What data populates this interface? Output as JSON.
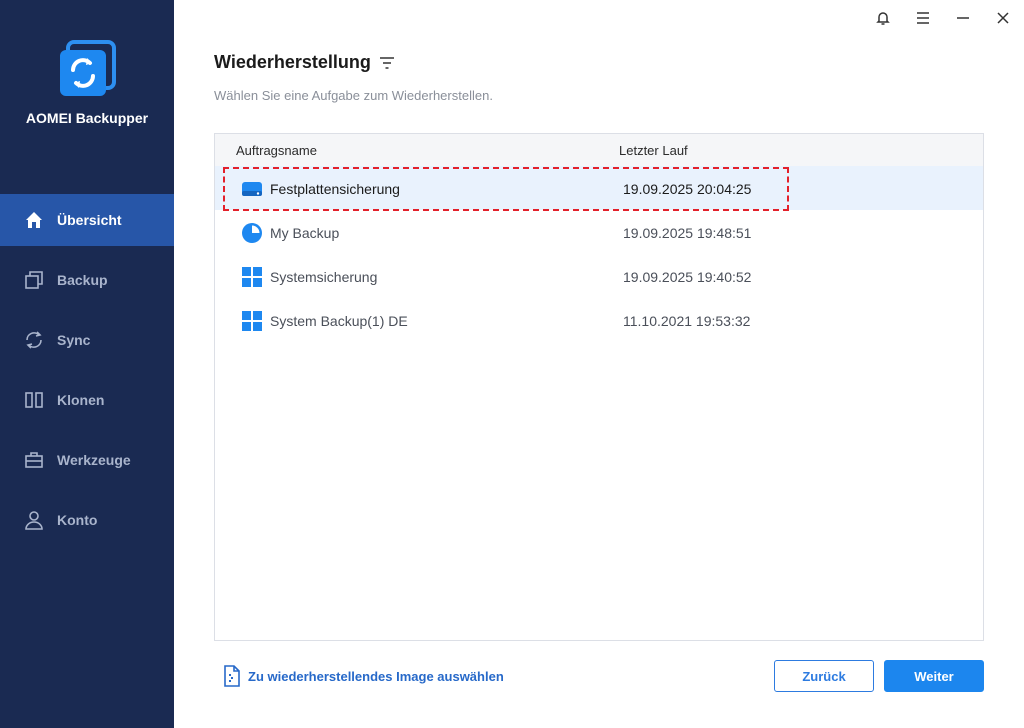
{
  "app": {
    "name": "AOMEI Backupper"
  },
  "sidebar": {
    "items": [
      {
        "label": "Übersicht",
        "icon": "home-icon",
        "active": true
      },
      {
        "label": "Backup",
        "icon": "backup-icon",
        "active": false
      },
      {
        "label": "Sync",
        "icon": "sync-icon",
        "active": false
      },
      {
        "label": "Klonen",
        "icon": "clone-icon",
        "active": false
      },
      {
        "label": "Werkzeuge",
        "icon": "toolbox-icon",
        "active": false
      },
      {
        "label": "Konto",
        "icon": "user-icon",
        "active": false
      }
    ]
  },
  "window_controls": [
    "bell-icon",
    "menu-icon",
    "minimize-icon",
    "close-icon"
  ],
  "main": {
    "title": "Wiederherstellung",
    "subtitle": "Wählen Sie eine Aufgabe zum Wiederherstellen."
  },
  "table": {
    "columns": [
      "Auftragsname",
      "Letzter Lauf"
    ],
    "rows": [
      {
        "name": "Festplattensicherung",
        "last_run": "19.09.2025 20:04:25",
        "icon": "disk-icon",
        "selected": true
      },
      {
        "name": "My Backup",
        "last_run": "19.09.2025 19:48:51",
        "icon": "pie-icon",
        "selected": false
      },
      {
        "name": "Systemsicherung",
        "last_run": "19.09.2025 19:40:52",
        "icon": "windows-icon",
        "selected": false
      },
      {
        "name": "System Backup(1) DE",
        "last_run": "11.10.2021 19:53:32",
        "icon": "windows-icon",
        "selected": false
      }
    ]
  },
  "footer": {
    "select_image_link": "Zu wiederherstellendes Image auswählen",
    "back_label": "Zurück",
    "next_label": "Weiter"
  },
  "colors": {
    "sidebar_bg": "#1a2a52",
    "sidebar_active": "#2756a8",
    "accent": "#1c86ee",
    "highlight": "#e3202a"
  }
}
